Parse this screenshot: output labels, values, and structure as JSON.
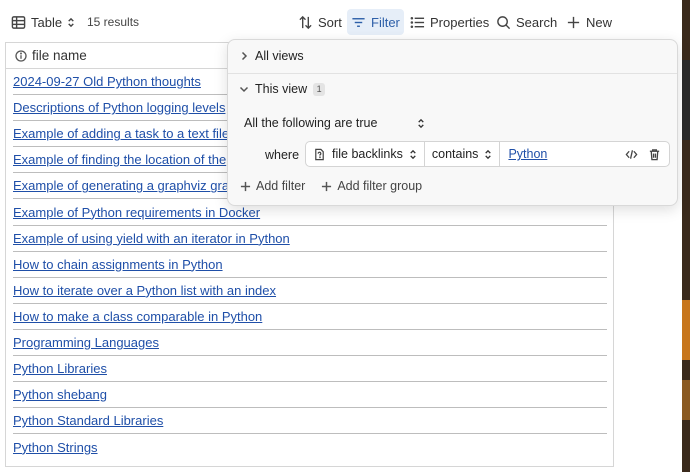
{
  "toolbar": {
    "view_label": "Table",
    "results": "15 results",
    "sort": "Sort",
    "filter": "Filter",
    "properties": "Properties",
    "search": "Search",
    "new": "New"
  },
  "table": {
    "column_header": "file name",
    "rows": [
      "2024-09-27 Old Python thoughts",
      "Descriptions of Python logging levels",
      "Example of adding a task to a text file",
      "Example of finding the location of the",
      "Example of generating a graphviz gra",
      "Example of Python requirements in Docker",
      "Example of using yield with an iterator in Python",
      "How to chain assignments in Python",
      "How to iterate over a Python list with an index",
      "How to make a class comparable in Python",
      "Programming Languages",
      "Python Libraries",
      "Python shebang",
      "Python Standard Libraries",
      "Python Strings"
    ]
  },
  "filter_popover": {
    "all_views": "All views",
    "this_view": "This view",
    "this_view_count": "1",
    "mode": "All the following are true",
    "where": "where",
    "property": "file backlinks",
    "operator": "contains",
    "value": "Python",
    "add_filter": "Add filter",
    "add_filter_group": "Add filter group"
  }
}
